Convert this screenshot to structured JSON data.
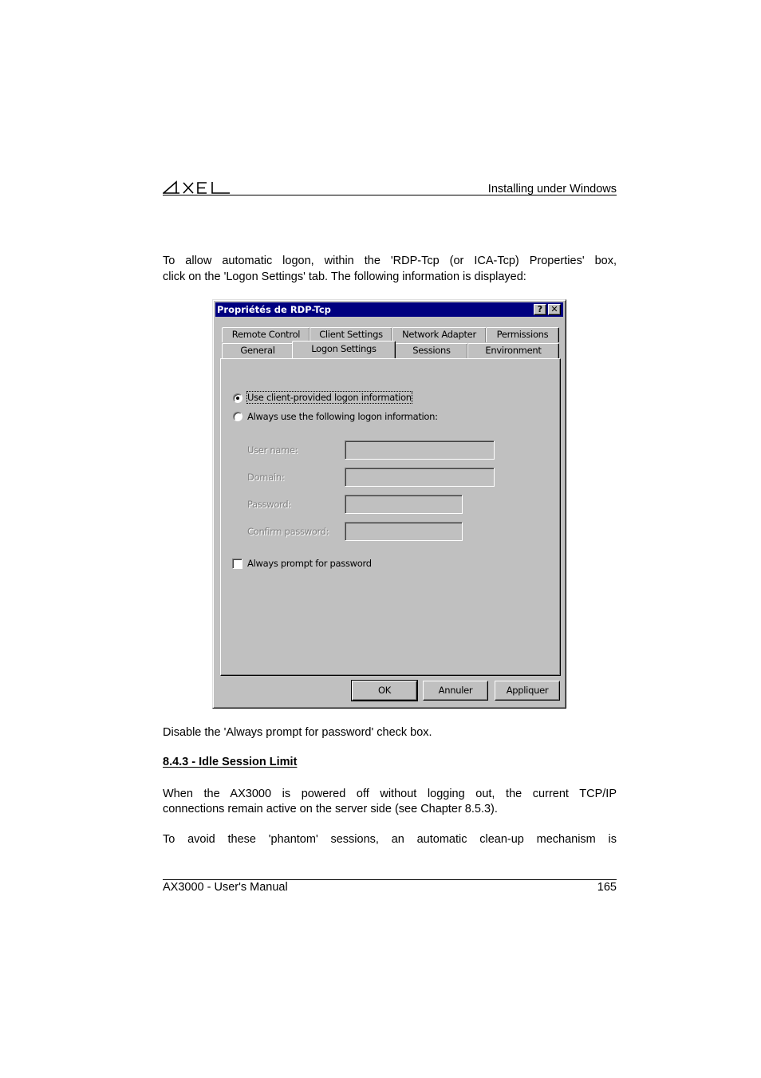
{
  "header": {
    "logo_text": "AXEL",
    "section_title": "Installing under Windows"
  },
  "intro": {
    "line1": "To allow automatic logon, within the 'RDP-Tcp (or ICA-Tcp) Properties' box,",
    "line2": "click on the 'Logon Settings' tab. The following information is displayed:"
  },
  "dialog": {
    "title": "Propriétés de RDP-Tcp",
    "help_button": "?",
    "close_button": "✕",
    "tabs_row1": [
      "Remote Control",
      "Client Settings",
      "Network Adapter",
      "Permissions"
    ],
    "tabs_row2": [
      "General",
      "Logon Settings",
      "Sessions",
      "Environment"
    ],
    "active_tab": "Logon Settings",
    "radio_client": {
      "label": "Use client-provided logon information",
      "selected": true
    },
    "radio_always": {
      "label": "Always use the following logon information:",
      "selected": false
    },
    "fields": [
      {
        "label": "User name:",
        "value": "",
        "enabled": false
      },
      {
        "label": "Domain:",
        "value": "",
        "enabled": false
      },
      {
        "label": "Password:",
        "value": "",
        "enabled": false
      },
      {
        "label": "Confirm password:",
        "value": "",
        "enabled": false
      }
    ],
    "checkbox_prompt": {
      "label": "Always prompt for password",
      "checked": false
    },
    "buttons": {
      "ok": "OK",
      "cancel": "Annuler",
      "apply": "Appliquer"
    }
  },
  "after_dialog": "Disable the 'Always prompt for password' check box.",
  "section_heading": "8.4.3 - Idle Session Limit",
  "para2": {
    "line1": "When the AX3000 is powered off without logging out, the current TCP/IP",
    "line2": "connections remain active on the server side (see Chapter 8.5.3)."
  },
  "para3": {
    "line1": "To avoid these 'phantom' sessions, an automatic clean-up mechanism is"
  },
  "footer": {
    "manual_title": "AX3000 - User's Manual",
    "page_number": "165"
  }
}
